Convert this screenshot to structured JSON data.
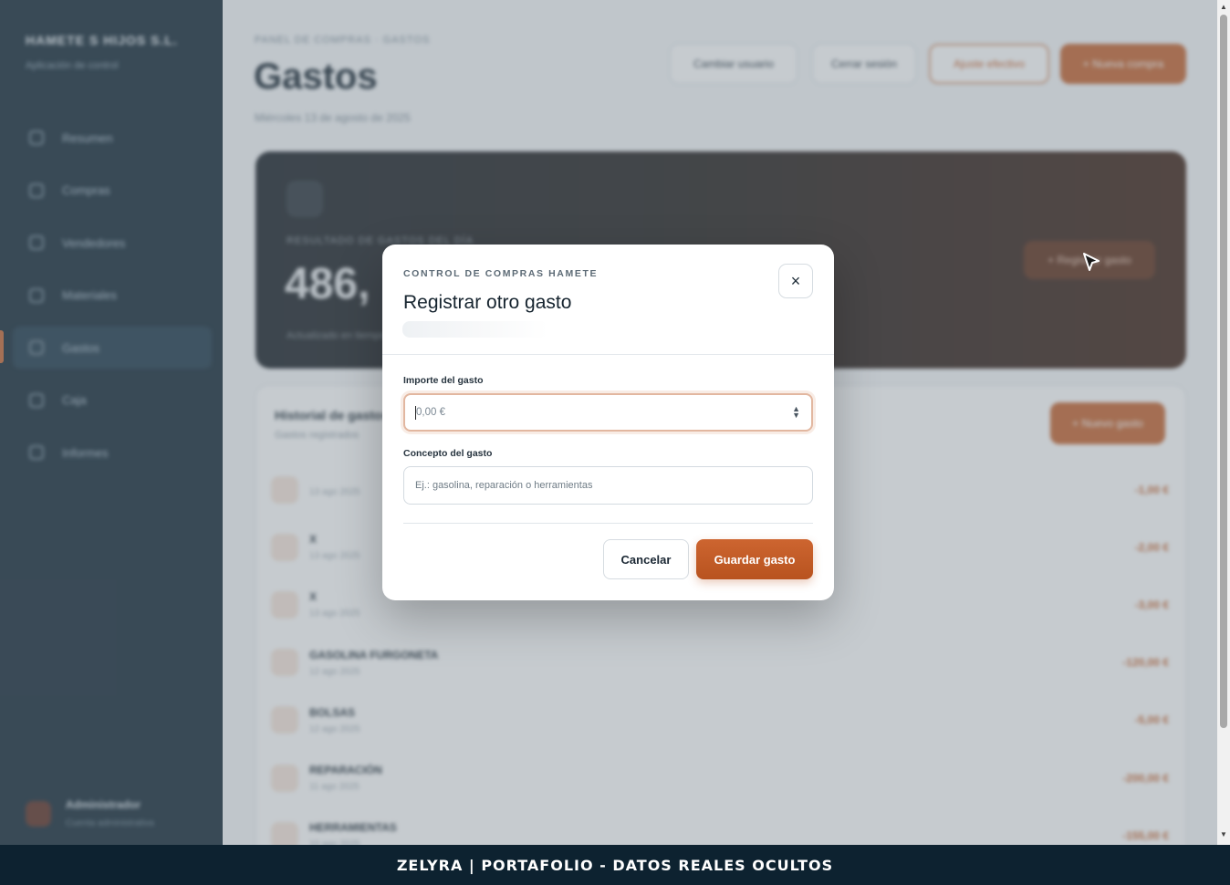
{
  "sidebar": {
    "brand_name": "HAMETE S HIJOS S.L.",
    "brand_sub": "Aplicación de control",
    "items": [
      {
        "label": "Resumen"
      },
      {
        "label": "Compras"
      },
      {
        "label": "Vendedores"
      },
      {
        "label": "Materiales"
      },
      {
        "label": "Gastos"
      },
      {
        "label": "Caja"
      },
      {
        "label": "Informes"
      }
    ],
    "user": {
      "name": "Administrador",
      "role": "Cuenta administrativa"
    }
  },
  "header": {
    "breadcrumb": "PANEL DE COMPRAS · GASTOS",
    "title": "Gastos",
    "subtitle": "Miércoles 13 de agosto de 2025",
    "buttons": [
      "Cambiar usuario",
      "Cerrar sesión",
      "Ajuste efectivo",
      "+ Nueva compra"
    ]
  },
  "hero": {
    "label": "RESULTADO DE GASTOS DEL DÍA",
    "value": "486,",
    "note": "Actualizado en tiempo real",
    "button": "+ Registrar gasto"
  },
  "list": {
    "title": "Historial de gastos",
    "subtitle": "Gastos registrados",
    "button": "+ Nuevo gasto",
    "rows": [
      {
        "title": "",
        "sub": "13 ago 2025",
        "amount": "-1,00 €"
      },
      {
        "title": "X",
        "sub": "13 ago 2025",
        "amount": "-2,00 €"
      },
      {
        "title": "X",
        "sub": "13 ago 2025",
        "amount": "-3,00 €"
      },
      {
        "title": "GASOLINA FURGONETA",
        "sub": "12 ago 2025",
        "amount": "-120,00 €"
      },
      {
        "title": "BOLSAS",
        "sub": "12 ago 2025",
        "amount": "-5,00 €"
      },
      {
        "title": "REPARACIÓN",
        "sub": "11 ago 2025",
        "amount": "-200,00 €"
      },
      {
        "title": "HERRAMIENTAS",
        "sub": "10 ago 2025",
        "amount": "-155,00 €"
      }
    ]
  },
  "modal": {
    "eyebrow": "CONTROL DE COMPRAS HAMETE",
    "title": "Registrar otro gasto",
    "close_icon": "×",
    "amount_label": "Importe del gasto",
    "amount_placeholder": "0,00 €",
    "concept_label": "Concepto del gasto",
    "concept_placeholder": "Ej.: gasolina, reparación o herramientas",
    "cancel_label": "Cancelar",
    "save_label": "Guardar gasto"
  },
  "footer": {
    "text": "ZELYRA | PORTAFOLIO - DATOS REALES OCULTOS"
  },
  "colors": {
    "accent": "#c4602a",
    "sidebar_bg": "#0d2230"
  }
}
